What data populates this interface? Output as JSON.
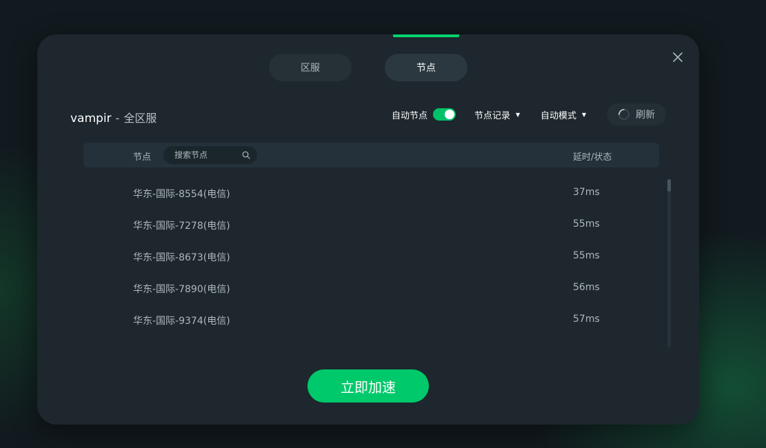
{
  "tabs": [
    {
      "label": "区服",
      "active": false
    },
    {
      "label": "节点",
      "active": true
    }
  ],
  "header": {
    "game": "vampir",
    "separator": "-",
    "region": "全区服"
  },
  "controls": {
    "auto_node_label": "自动节点",
    "auto_node_enabled": true,
    "node_history_label": "节点记录",
    "auto_mode_label": "自动模式",
    "refresh_label": "刷新"
  },
  "table": {
    "col_node": "节点",
    "search_placeholder": "搜索节点",
    "col_latency": "延时/状态",
    "rows": [
      {
        "name": "华东-国际-8554(电信)",
        "latency": "37ms"
      },
      {
        "name": "华东-国际-7278(电信)",
        "latency": "55ms"
      },
      {
        "name": "华东-国际-8673(电信)",
        "latency": "55ms"
      },
      {
        "name": "华东-国际-7890(电信)",
        "latency": "56ms"
      },
      {
        "name": "华东-国际-9374(电信)",
        "latency": "57ms"
      }
    ]
  },
  "accelerate_label": "立即加速",
  "colors": {
    "accent": "#00c96b",
    "dialog_bg": "#1d272d",
    "text_muted": "#aeb8bd"
  },
  "icons": {
    "close": "close-icon",
    "search": "search-icon",
    "refresh": "refresh-spinner-icon",
    "dropdown": "caret-down-icon"
  }
}
